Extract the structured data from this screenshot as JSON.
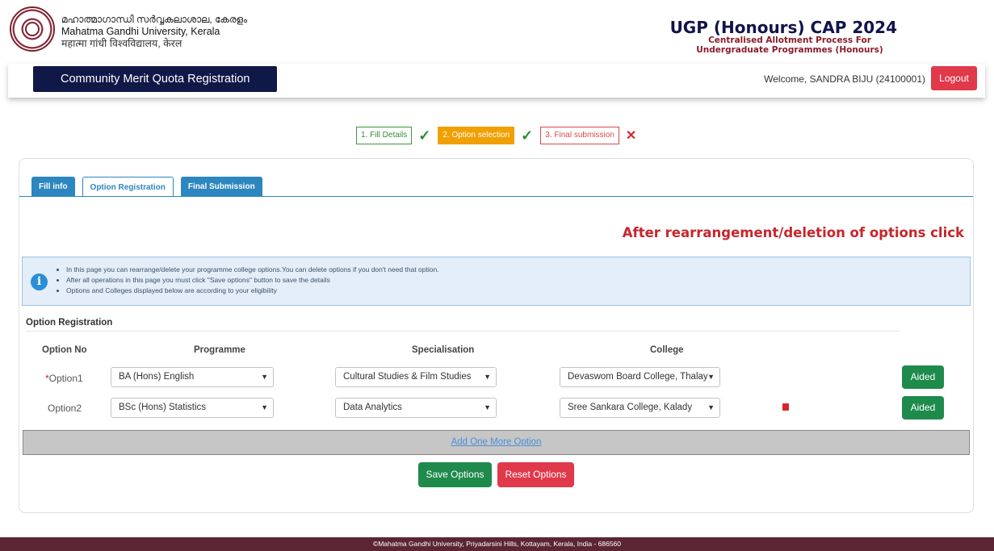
{
  "header": {
    "uni_name_ml": "മഹാത്മാഗാന്ധി സർവ്വകലാശാല, കേരളം",
    "uni_name_en": "Mahatma Gandhi University, Kerala",
    "uni_name_hi": "महात्मा गांधी विश्वविद्यालय, केरल",
    "cap_title": "UGP (Honours) CAP 2024",
    "cap_sub1": "Centralised Allotment Process For",
    "cap_sub2": "Undergraduate Programmes (Honours)"
  },
  "topbar": {
    "title": "Community Merit Quota Registration",
    "welcome": "Welcome, SANDRA BIJU (24100001)",
    "logout": "Logout"
  },
  "steps": {
    "step1": "1. Fill Details",
    "step2": "2. Option selection",
    "step3": "3. Final submission"
  },
  "tabs": {
    "fill_info": "Fill info",
    "option_registration": "Option Registration",
    "final_submission": "Final Submission"
  },
  "notice": "After rearrangement/deletion of options click",
  "info": {
    "line1": "In this page you can rearrange/delete your programme college options.You can delete options if you don't need that option.",
    "line2": "After all operations in this page you must click \"Save options\" button to save the details",
    "line3": "Options and Colleges displayed below are according to your eligibility"
  },
  "section_title": "Option Registration",
  "table": {
    "headers": {
      "option_no": "Option No",
      "programme": "Programme",
      "specialisation": "Specialisation",
      "college": "College"
    },
    "rows": [
      {
        "label_req": "*",
        "label": "Option1",
        "programme": "BA (Hons) English",
        "specialisation": "Cultural Studies & Film Studies",
        "college": "Devaswom Board College, Thalay",
        "type": "Aided"
      },
      {
        "label_req": "",
        "label": "Option2",
        "programme": "BSc (Hons) Statistics",
        "specialisation": "Data Analytics",
        "college": "Sree Sankara College, Kalady",
        "type": "Aided"
      }
    ]
  },
  "add_more": "Add One More Option",
  "buttons": {
    "save": "Save Options",
    "reset": "Reset Options"
  },
  "footer": "©Mahatma Gandhi University, Priyadarsini Hills, Kottayam, Kerala, India - 686560",
  "colors": {
    "navy": "#0f1847",
    "danger": "#e0394a",
    "success": "#1e8a4c",
    "tab_blue": "#2c86bf",
    "footer": "#5c2534",
    "step_orange": "#f0a000"
  },
  "icons": [
    "university-logo",
    "check-icon",
    "cross-icon",
    "info-icon",
    "chevron-down-icon",
    "trash-icon"
  ]
}
